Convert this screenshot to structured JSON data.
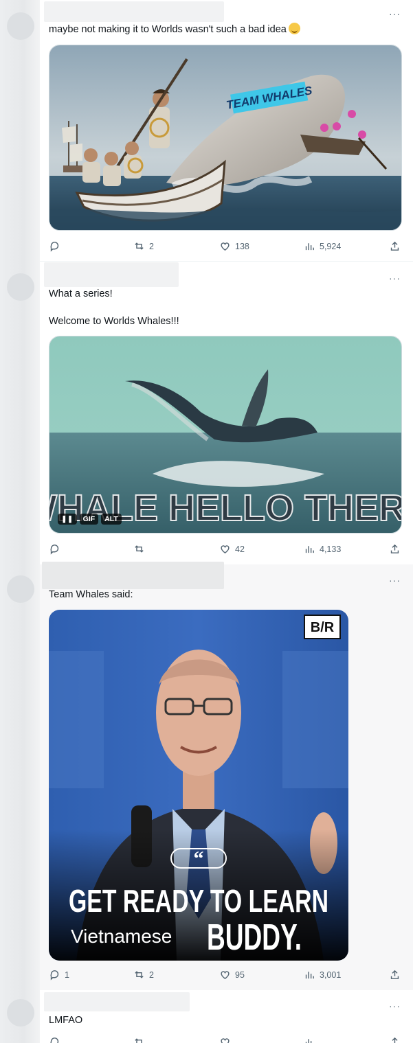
{
  "tweets": [
    {
      "text": "maybe not making it to Worlds wasn't such a bad idea",
      "emoji": "sweat-smile-emoji",
      "media_caption": "TEAM WHALES",
      "stats": {
        "replies": "",
        "retweets": "2",
        "likes": "138",
        "views": "5,924"
      }
    },
    {
      "text_line1": "What a series!",
      "text_line2": "Welcome to Worlds Whales!!!",
      "media_caption": "WHALE HELLO THERE",
      "media_badges": [
        "GIF",
        "ALT"
      ],
      "stats": {
        "replies": "",
        "retweets": "",
        "likes": "42",
        "views": "4,133"
      }
    },
    {
      "text": "Team Whales said:",
      "media_logo": "B/R",
      "media_caption_line1": "GET READY TO LEARN",
      "media_caption_small": "Vietnamese",
      "media_caption_big": "BUDDY.",
      "stats": {
        "replies": "1",
        "retweets": "2",
        "likes": "95",
        "views": "3,001"
      }
    },
    {
      "text": "LMFAO"
    }
  ],
  "more_label": "···"
}
